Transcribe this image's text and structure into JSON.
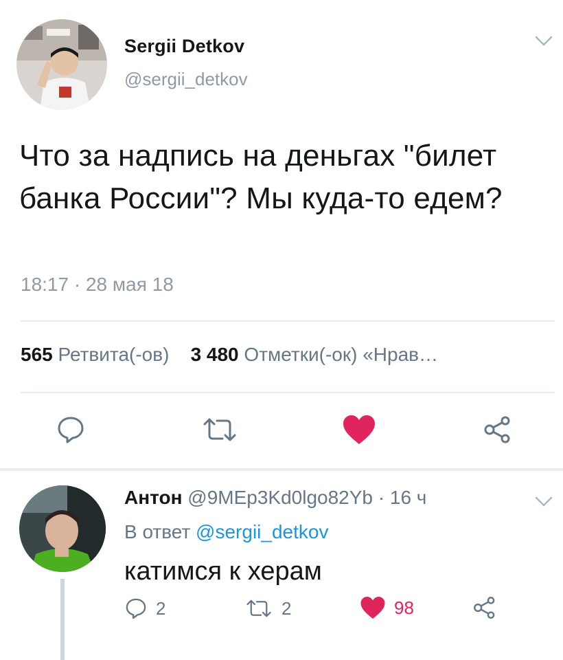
{
  "tweet": {
    "author_name": "Sergii Detkov",
    "author_handle": "@sergii_detkov",
    "text": "Что за надпись на деньгах \"билет банка России\"? Мы куда-то едем?",
    "timestamp": "18:17 · 28 мая 18",
    "retweets_count": "565",
    "retweets_label": "Ретвита(-ов)",
    "likes_count": "3 480",
    "likes_label": "Отметки(-ок)",
    "more_label": "«Нрав…"
  },
  "reply": {
    "author_name": "Антон",
    "meta": "@9MEp3Kd0lgo82Yb · 16 ч",
    "reply_prefix": "В ответ",
    "reply_to_handle": "@sergii_detkov",
    "text": "катимся к херам",
    "replies_count": "2",
    "retweets_count": "2",
    "likes_count": "98"
  },
  "colors": {
    "like_red": "#e0245e",
    "link_blue": "#1b95e0",
    "icon_gray": "#657786",
    "muted_text": "#8f9aa4"
  },
  "icons": {
    "menu": "chevron-down-icon",
    "reply": "speech-bubble-icon",
    "retweet": "retweet-arrows-icon",
    "like": "heart-icon",
    "share": "share-icon"
  }
}
